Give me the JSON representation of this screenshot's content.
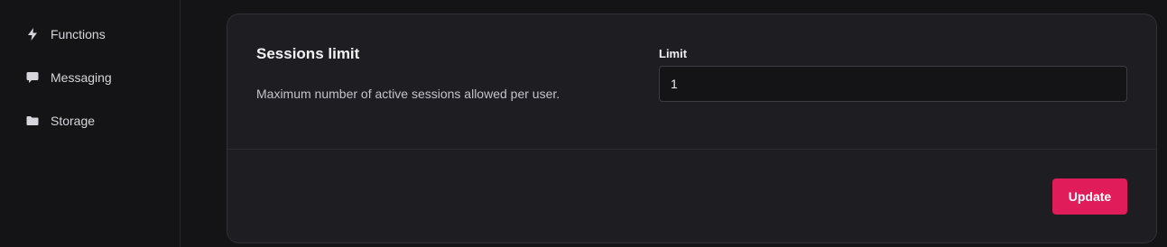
{
  "sidebar": {
    "items": [
      {
        "label": "Functions",
        "icon": "lightning-bolt-icon"
      },
      {
        "label": "Messaging",
        "icon": "chat-bubble-icon"
      },
      {
        "label": "Storage",
        "icon": "folder-icon"
      }
    ]
  },
  "card": {
    "title": "Sessions limit",
    "description": "Maximum number of active sessions allowed per user.",
    "field": {
      "label": "Limit",
      "value": "1",
      "placeholder": ""
    },
    "update_label": "Update"
  },
  "colors": {
    "background": "#141416",
    "card": "#1e1e22",
    "accent": "#e01d5a"
  }
}
